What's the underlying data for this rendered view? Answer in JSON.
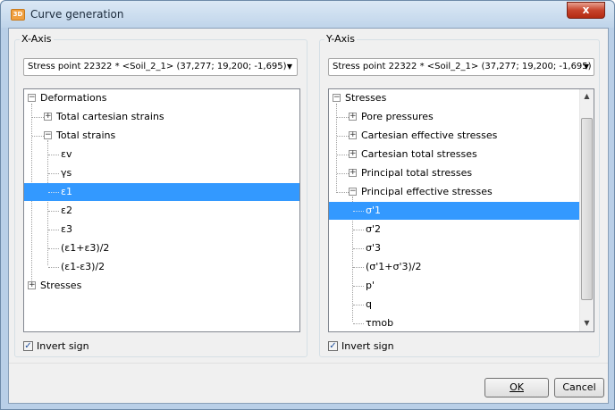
{
  "window": {
    "title": "Curve generation",
    "app_icon_text": "3D",
    "close_label": "x"
  },
  "x_axis": {
    "legend": "X-Axis",
    "combo_value": "Stress point 22322 * <Soil_2_1> (37,277; 19,200; -1,695)",
    "invert_label": "Invert sign",
    "invert_checked": true,
    "tree": {
      "deformations": "Deformations",
      "total_cartesian_strains": "Total cartesian strains",
      "total_strains": "Total strains",
      "ev": "εv",
      "gs": "γs",
      "e1": "ε1",
      "e2": "ε2",
      "e3": "ε3",
      "e1_plus_e3": "(ε1+ε3)/2",
      "e1_minus_e3": "(ε1-ε3)/2",
      "stresses": "Stresses"
    }
  },
  "y_axis": {
    "legend": "Y-Axis",
    "combo_value": "Stress point 22322 * <Soil_2_1> (37,277; 19,200; -1,695)",
    "invert_label": "Invert sign",
    "invert_checked": true,
    "tree": {
      "stresses": "Stresses",
      "pore_pressures": "Pore pressures",
      "cartesian_effective": "Cartesian effective stresses",
      "cartesian_total": "Cartesian total stresses",
      "principal_total": "Principal total stresses",
      "principal_effective": "Principal effective stresses",
      "s1": "σ'1",
      "s2": "σ'2",
      "s3": "σ'3",
      "s1_plus_s3": "(σ'1+σ'3)/2",
      "p": "p'",
      "q": "q",
      "tmob": "τmob"
    }
  },
  "buttons": {
    "ok": "OK",
    "cancel": "Cancel"
  }
}
